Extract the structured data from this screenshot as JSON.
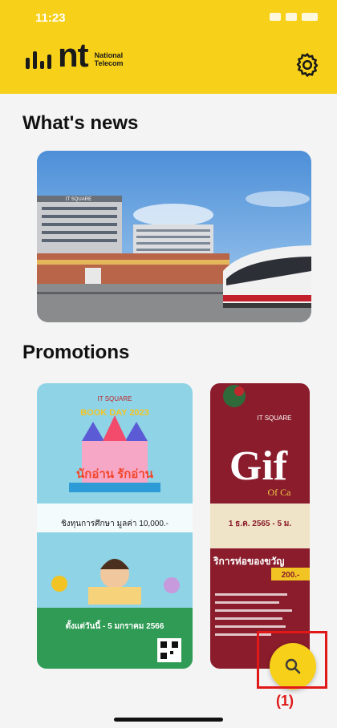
{
  "status": {
    "time": "11:23"
  },
  "header": {
    "brand_mark": "nt",
    "brand_sub_line1": "National",
    "brand_sub_line2": "Telecom"
  },
  "sections": {
    "news_title": "What's news",
    "promotions_title": "Promotions"
  },
  "news": {
    "sign_text": "IT SQUARE"
  },
  "promotions": [
    {
      "brand": "IT SQUARE",
      "event": "BOOK DAY 2023",
      "headline": "นักอ่าน รักอ่าน",
      "offer_line": "ชิงทุนการศึกษา มูลค่า 10,000.-",
      "date_line": "ตั้งแต่วันนี้ - 5 มกราคม 2566"
    },
    {
      "brand": "IT SQUARE",
      "headline": "Gif",
      "sub": "Of Ca",
      "date_line": "1 ธ.ค. 2565 - 5 ม.",
      "service_line": "ริการห่อของขวัญ",
      "price": "200.-"
    }
  ],
  "annotation": {
    "label": "(1)"
  },
  "colors": {
    "brand_yellow": "#f7d01a",
    "highlight_red": "#e01818"
  }
}
